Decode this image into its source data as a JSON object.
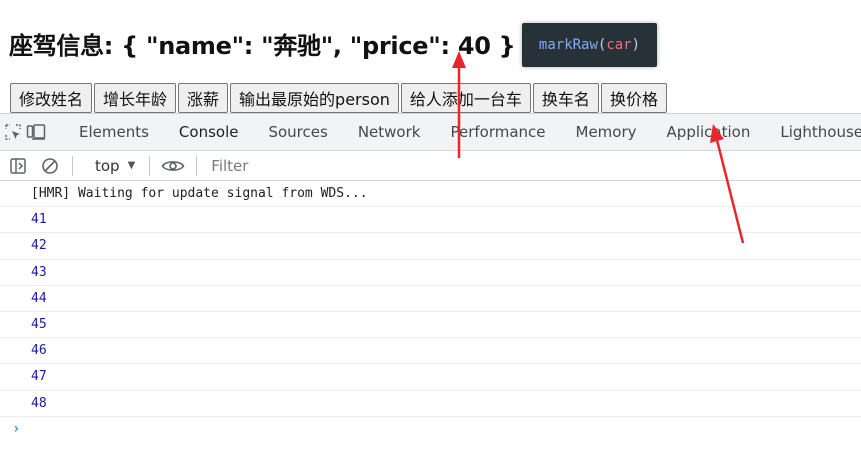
{
  "page": {
    "heading_prefix": "座驾信息: { \"name\": \"奔驰\", \"price\": ",
    "heading_price": "40",
    "heading_suffix": " }"
  },
  "code_badge": {
    "fn": "markRaw",
    "open": "(",
    "arg": "car",
    "close": ")"
  },
  "buttons": [
    {
      "label": "修改姓名"
    },
    {
      "label": "增长年龄"
    },
    {
      "label": "涨薪"
    },
    {
      "label": "输出最原始的person"
    },
    {
      "label": "给人添加一台车"
    },
    {
      "label": "换车名"
    },
    {
      "label": "换价格"
    }
  ],
  "devtools": {
    "tabs": [
      {
        "label": "Elements"
      },
      {
        "label": "Console"
      },
      {
        "label": "Sources"
      },
      {
        "label": "Network"
      },
      {
        "label": "Performance"
      },
      {
        "label": "Memory"
      },
      {
        "label": "Application"
      },
      {
        "label": "Lighthouse"
      }
    ],
    "active_tab": "Console",
    "context": "top",
    "filter_placeholder": "Filter",
    "console_lines": [
      {
        "kind": "msg",
        "text": "[HMR] Waiting for update signal from WDS..."
      },
      {
        "kind": "num",
        "text": "41"
      },
      {
        "kind": "num",
        "text": "42"
      },
      {
        "kind": "num",
        "text": "43"
      },
      {
        "kind": "num",
        "text": "44"
      },
      {
        "kind": "num",
        "text": "45"
      },
      {
        "kind": "num",
        "text": "46"
      },
      {
        "kind": "num",
        "text": "47"
      },
      {
        "kind": "num",
        "text": "48"
      }
    ],
    "prompt": "›"
  },
  "colors": {
    "accent": "#1a73e8",
    "annotation_arrow": "#e8262b",
    "badge_bg": "#263238",
    "number_log": "#1a1aa6"
  }
}
